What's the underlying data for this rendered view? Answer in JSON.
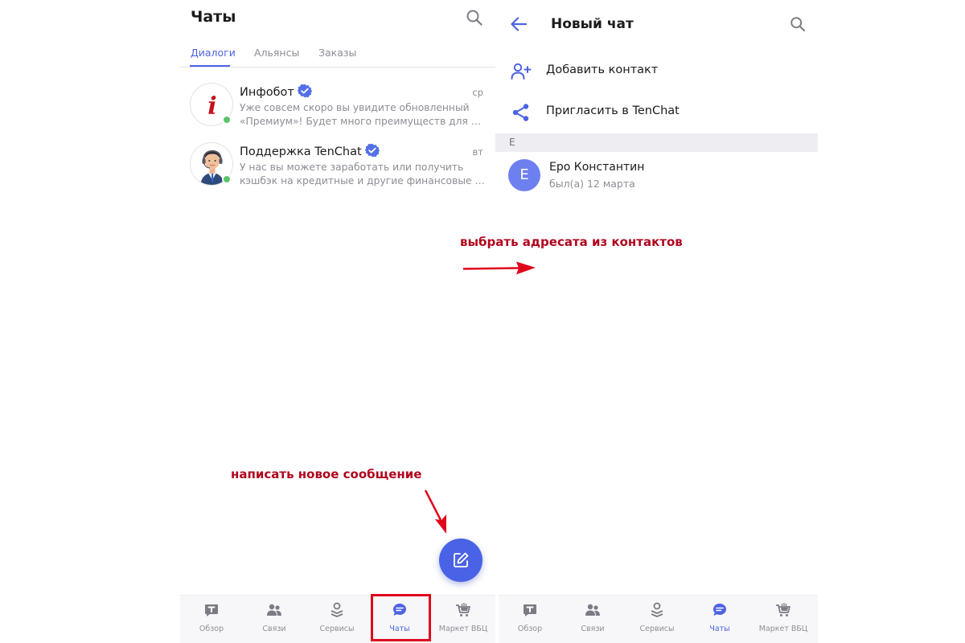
{
  "left": {
    "title": "Чаты",
    "tabs": [
      {
        "label": "Диалоги",
        "active": true
      },
      {
        "label": "Альянсы",
        "active": false
      },
      {
        "label": "Заказы",
        "active": false
      }
    ],
    "chats": [
      {
        "name": "Инфобот",
        "time": "ср",
        "preview_line1": "Уже совсем скоро вы увидите обновленный",
        "preview_line2": "«Премиум»! Будет много преимуществ для ав...",
        "avatar": "info-i",
        "verified": true,
        "online": true
      },
      {
        "name": "Поддержка TenChat",
        "time": "вт",
        "preview_line1": "У нас вы можете заработать или получить",
        "preview_line2": "кэшбэк на кредитные и другие финансовые у...",
        "avatar": "support-agent",
        "verified": true,
        "online": true
      }
    ],
    "fab_icon": "edit-icon"
  },
  "right": {
    "title": "Новый чат",
    "actions": [
      {
        "label": "Добавить контакт",
        "icon": "add-person-icon"
      },
      {
        "label": "Пригласить в TenChat",
        "icon": "share-icon"
      }
    ],
    "section_letter": "Е",
    "contact": {
      "initial": "Е",
      "name": "Еро Константин",
      "status": "был(а) 12 марта"
    }
  },
  "nav": [
    {
      "label": "Обзор",
      "icon": "tenchat-t-icon"
    },
    {
      "label": "Связи",
      "icon": "people-icon"
    },
    {
      "label": "Сервисы",
      "icon": "stack-icon"
    },
    {
      "label": "Чаты",
      "icon": "chat-bubble-icon",
      "active": true
    },
    {
      "label": "Маркет ВБЦ",
      "icon": "cart-icon"
    }
  ],
  "annotations": {
    "contacts": "выбрать адресата из контактов",
    "new_message": "написать новое сообщение"
  },
  "colors": {
    "accent": "#4d63e4",
    "annotation": "#b0061e",
    "highlight": "#e0061c",
    "online": "#5cc46a",
    "muted": "#8d8d95"
  }
}
